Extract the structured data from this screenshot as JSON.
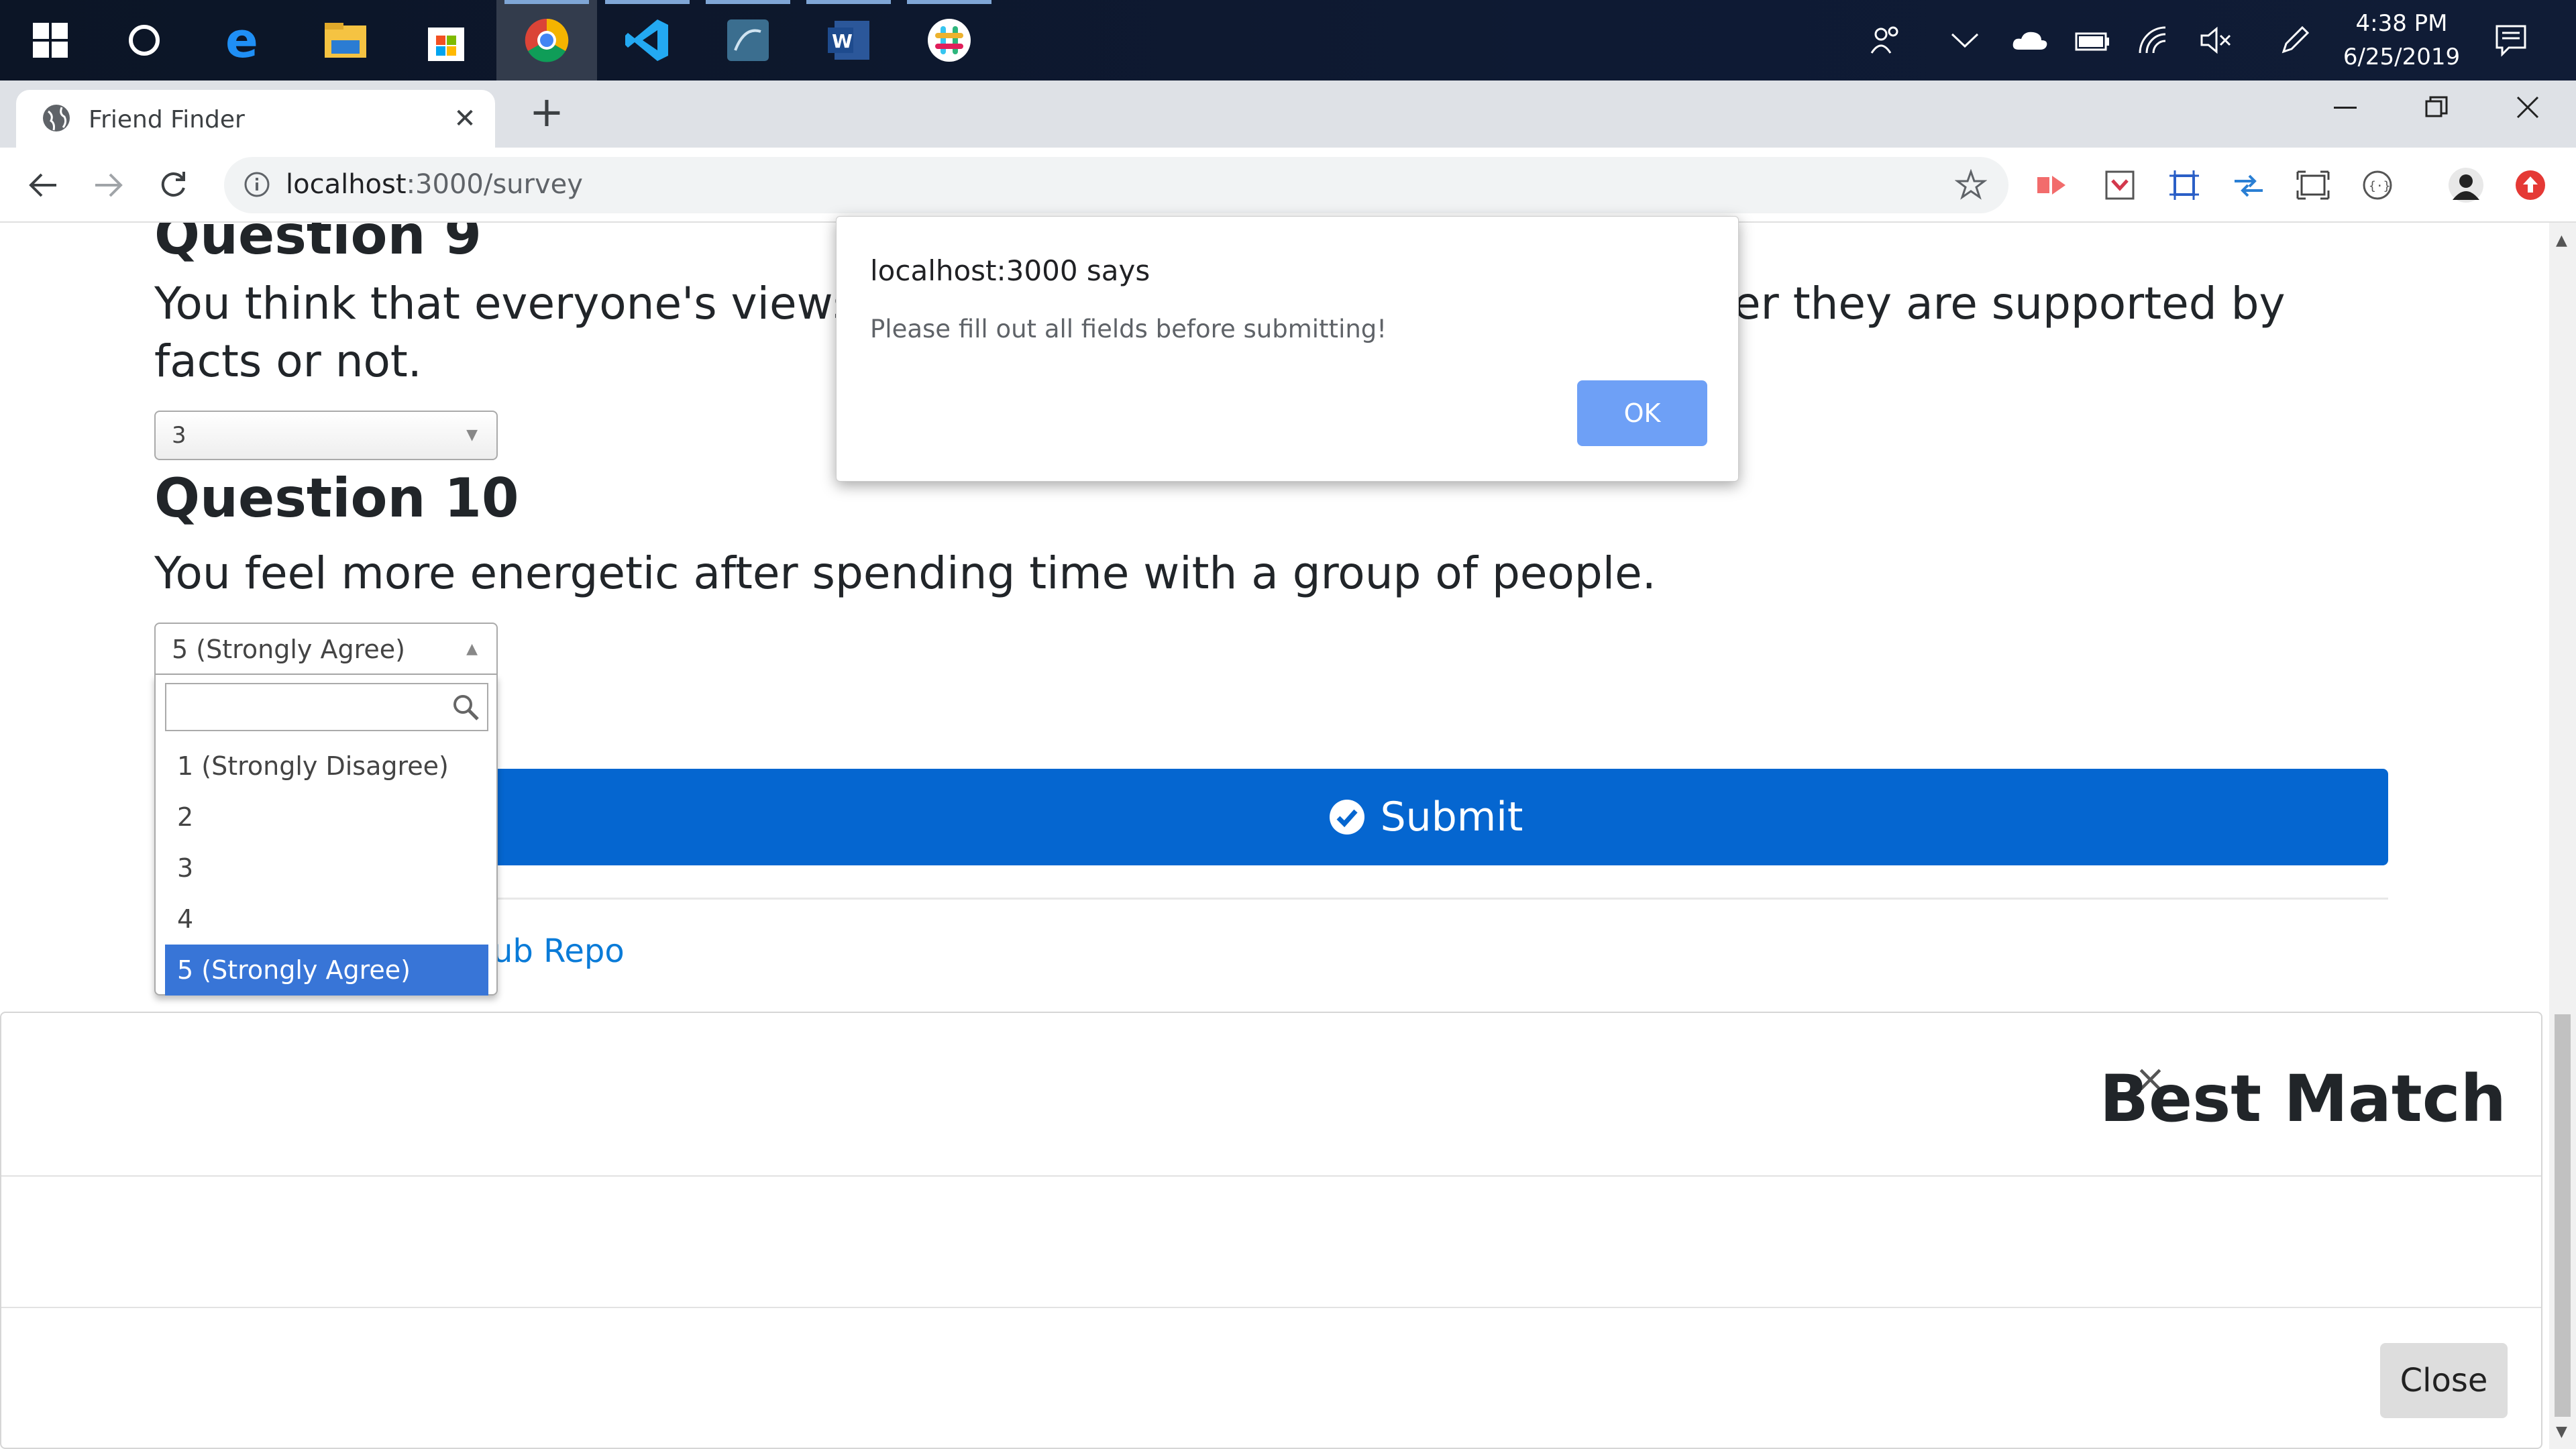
{
  "taskbar": {
    "clock_time": "4:38 PM",
    "clock_date": "6/25/2019"
  },
  "browser": {
    "tab_title": "Friend Finder",
    "tab_close": "✕",
    "new_tab": "+",
    "url_host": "localhost",
    "url_path": ":3000/survey"
  },
  "survey": {
    "q9_title": "Question 9",
    "q9_text_left": "You think that everyone's views",
    "q9_text_right": "er they are supported by",
    "q9_text_line2": "facts or not.",
    "q9_value": "3",
    "q10_title": "Question 10",
    "q10_text": "You feel more energetic after spending time with a group of people.",
    "q10_value": "5 (Strongly Agree)",
    "q10_options": [
      "1 (Strongly Disagree)",
      "2",
      "3",
      "4",
      "5 (Strongly Agree)"
    ],
    "submit_label": "Submit",
    "repo_link": "ub Repo"
  },
  "modal": {
    "close_x": "×",
    "title": "Best Match",
    "close_button": "Close"
  },
  "alert": {
    "title": "localhost:3000 says",
    "message": "Please fill out all fields before submitting!",
    "ok_label": "OK"
  },
  "colors": {
    "submit_bg": "#0566d0",
    "alert_ok_bg": "#6ea0f6",
    "option_selected_bg": "#3875d7",
    "link": "#0a7bd8"
  }
}
